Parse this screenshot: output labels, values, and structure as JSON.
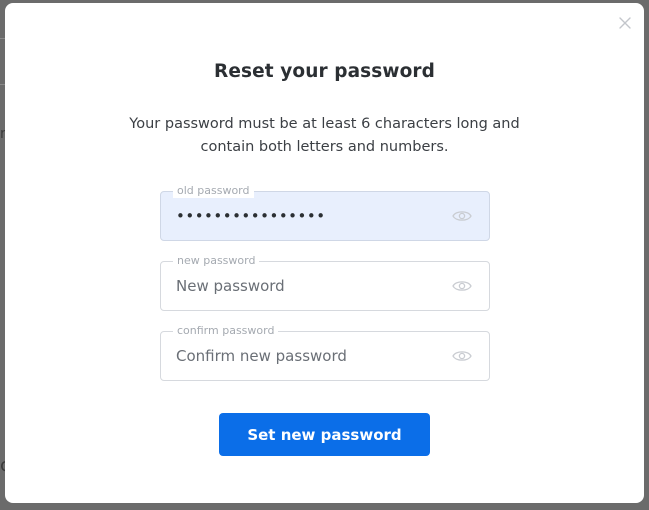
{
  "modal": {
    "title": "Reset your password",
    "description": "Your password must be at least 6 characters long and contain both letters and numbers.",
    "close_icon": "close-icon",
    "fields": [
      {
        "label": "old password",
        "value": "••••••••••••••••",
        "placeholder": "",
        "type": "password",
        "icon": "eye-icon"
      },
      {
        "label": "new password",
        "value": "",
        "placeholder": "New password",
        "type": "password",
        "icon": "eye-icon"
      },
      {
        "label": "confirm password",
        "value": "",
        "placeholder": "Confirm new password",
        "type": "password",
        "icon": "eye-icon"
      }
    ],
    "submit_label": "Set new password"
  },
  "colors": {
    "primary": "#0b6ee8",
    "filled_field_bg": "#e8effd",
    "overlay": "#6b6b6b"
  }
}
